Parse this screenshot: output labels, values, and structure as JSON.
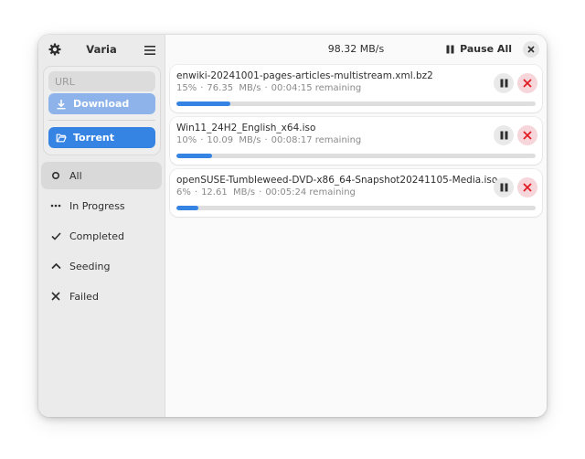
{
  "sidebar": {
    "title": "Varia",
    "settings_icon": "gear-icon",
    "menu_icon": "hamburger-menu-icon",
    "url_placeholder": "URL",
    "url_value": "",
    "download_label": "Download",
    "download_icon": "download-arrow-icon",
    "torrent_label": "Torrent",
    "torrent_icon": "folder-open-icon",
    "filters": [
      {
        "label": "All",
        "icon": "circle-icon",
        "active": true
      },
      {
        "label": "In Progress",
        "icon": "dots-icon",
        "active": false
      },
      {
        "label": "Completed",
        "icon": "check-icon",
        "active": false
      },
      {
        "label": "Seeding",
        "icon": "chevron-up-icon",
        "active": false
      },
      {
        "label": "Failed",
        "icon": "x-icon",
        "active": false
      }
    ]
  },
  "header": {
    "total_speed": "98.32 MB/s",
    "pause_all_label": "Pause All",
    "pause_all_icon": "pause-icon",
    "close_icon": "close-icon"
  },
  "colors": {
    "accent": "#3584e4",
    "accent_disabled": "#8db3ea",
    "cancel_bg": "#f6d6da",
    "cancel_fg": "#e01b24"
  },
  "downloads": [
    {
      "filename": "enwiki-20241001-pages-articles-multistream.xml.bz2",
      "percent": "15%",
      "progress": 0.15,
      "speed": "76.35  MB/s",
      "remaining": "00:04:15 remaining"
    },
    {
      "filename": "Win11_24H2_English_x64.iso",
      "percent": "10%",
      "progress": 0.1,
      "speed": "10.09  MB/s",
      "remaining": "00:08:17 remaining"
    },
    {
      "filename": "openSUSE-Tumbleweed-DVD-x86_64-Snapshot20241105-Media.iso",
      "percent": "6%",
      "progress": 0.06,
      "speed": "12.61  MB/s",
      "remaining": "00:05:24 remaining"
    }
  ]
}
